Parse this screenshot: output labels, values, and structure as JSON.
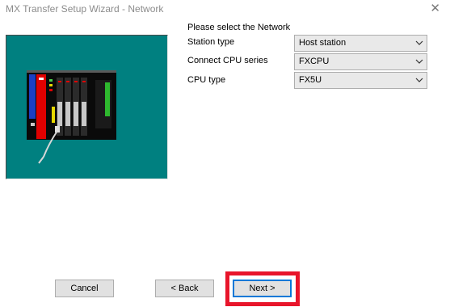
{
  "window": {
    "title": "MX Transfer Setup Wizard - Network",
    "close_glyph": "✕"
  },
  "illustration": {
    "icon": "plc-rack-illustration",
    "background_color": "#008080"
  },
  "form": {
    "prompt": "Please select the Network",
    "fields": [
      {
        "label": "Station type",
        "value": "Host station"
      },
      {
        "label": "Connect CPU series",
        "value": "FXCPU"
      },
      {
        "label": "CPU type",
        "value": "FX5U"
      }
    ]
  },
  "buttons": {
    "cancel": "Cancel",
    "back": "< Back",
    "next": "Next >"
  },
  "colors": {
    "highlight": "#e8152b",
    "focus": "#0078d7",
    "button_face": "#e1e1e1",
    "select_face": "#e9e9e9"
  }
}
